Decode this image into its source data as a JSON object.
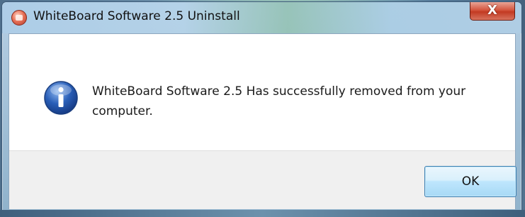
{
  "window": {
    "title": "WhiteBoard Software 2.5 Uninstall",
    "close_glyph": "X",
    "app_icon": "uninstall-app-icon"
  },
  "dialog": {
    "icon": "information-icon",
    "message": "WhiteBoard Software 2.5 Has successfully removed from your computer.",
    "ok_label": "OK"
  },
  "colors": {
    "close_button": "#c23a22",
    "ok_button_border": "#3c7fb1",
    "info_icon_blue": "#2a5fb8"
  }
}
